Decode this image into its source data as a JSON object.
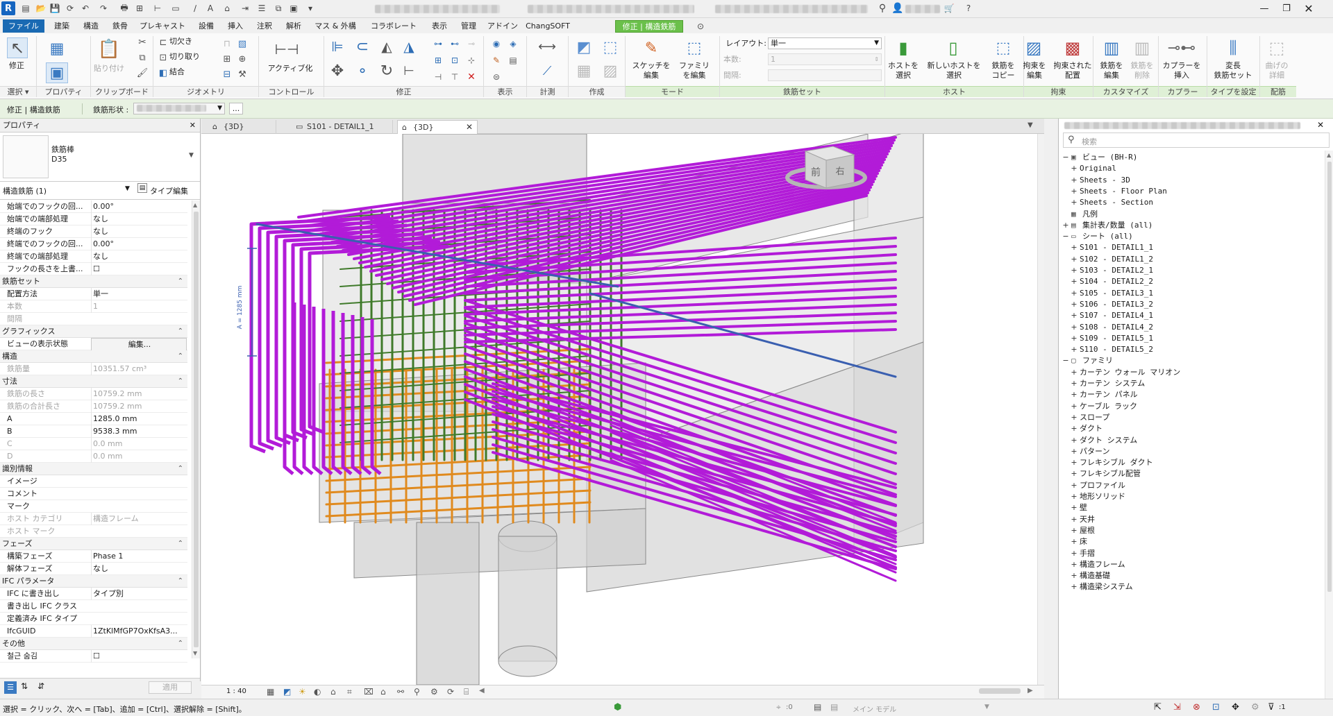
{
  "title_bar": {
    "app_logo": "R",
    "quick_access_icons": [
      "open-icon",
      "save-icon",
      "sync-icon",
      "undo-icon",
      "redo-icon",
      "print-icon",
      "measure-icon",
      "dimension-icon",
      "text-icon",
      "3d-view-icon",
      "section-icon",
      "close-hidden-icon",
      "switch-windows-icon"
    ],
    "window_buttons": [
      "minimize",
      "restore",
      "close"
    ]
  },
  "menu": {
    "file": "ファイル",
    "tabs": [
      "建築",
      "構造",
      "鉄骨",
      "プレキャスト",
      "設備",
      "挿入",
      "注釈",
      "解析",
      "マス & 外構",
      "コラボレート",
      "表示",
      "管理",
      "アドイン",
      "ChangSOFT"
    ],
    "context_tab": "修正 | 構造鉄筋"
  },
  "ribbon": {
    "modify": "修正",
    "properties": "プロパティ",
    "paste": "貼り付け",
    "cut": "切欠き",
    "join_cut": "切り取り",
    "join": "結合",
    "activate": "アクティブ化",
    "sketch_edit": "スケッチを\n編集",
    "family_edit": "ファミリ\nを編集",
    "layout_label": "レイアウト:",
    "layout_value": "単一",
    "count_label": "本数:",
    "count_value": "1",
    "spacing_label": "間隔:",
    "host_select": "ホストを\n選択",
    "new_host_select": "新しいホストを\n選択",
    "rebar_copy": "鉄筋を\nコピー",
    "constraint_edit": "拘束を\n編集",
    "constrained_place": "拘束された\n配置",
    "rebar_edit": "鉄筋を\n編集",
    "rebar_delete": "鉄筋を\n削除",
    "coupler_insert": "カプラーを\n挿入",
    "vary_set": "変長\n鉄筋セット",
    "bend_detail": "曲げの\n詳細",
    "panels": {
      "select": "選択",
      "properties": "プロパティ",
      "clipboard": "クリップボード",
      "geometry": "ジオメトリ",
      "control": "コントロール",
      "modify": "修正",
      "view": "表示",
      "measure": "計測",
      "create": "作成",
      "mode": "モード",
      "rebar_set": "鉄筋セット",
      "host": "ホスト",
      "constraint": "拘束",
      "customize": "カスタマイズ",
      "coupler": "カプラー",
      "set_type": "タイプを設定",
      "reinforcement": "配筋"
    }
  },
  "options_bar": {
    "context": "修正 | 構造鉄筋",
    "shape_label": "鉄筋形状 :",
    "more": "..."
  },
  "properties": {
    "header": "プロパティ",
    "family_name": "鉄筋棒",
    "type_name": "D35",
    "selector": "構造鉄筋 (1)",
    "edit_type": "タイプ編集",
    "rows": [
      {
        "k": "始端でのフックの回...",
        "v": "0.00°",
        "dis": false
      },
      {
        "k": "始端での端部処理",
        "v": "なし",
        "dis": false
      },
      {
        "k": "終端のフック",
        "v": "なし",
        "dis": false
      },
      {
        "k": "終端でのフックの回...",
        "v": "0.00°",
        "dis": false
      },
      {
        "k": "終端での端部処理",
        "v": "なし",
        "dis": false
      },
      {
        "k": "フックの長さを上書...",
        "v": "☐",
        "dis": false
      }
    ],
    "groups": [
      {
        "name": "鉄筋セット",
        "rows": [
          {
            "k": "配置方法",
            "v": "単一",
            "dis": false
          },
          {
            "k": "本数",
            "v": "1",
            "dis": true
          },
          {
            "k": "間隔",
            "v": "",
            "dis": true
          }
        ]
      },
      {
        "name": "グラフィックス",
        "rows": [
          {
            "k": "ビューの表示状態",
            "v": "編集...",
            "dis": false,
            "button": true
          }
        ]
      },
      {
        "name": "構造",
        "rows": [
          {
            "k": "鉄筋量",
            "v": "10351.57 cm³",
            "dis": true
          }
        ]
      },
      {
        "name": "寸法",
        "rows": [
          {
            "k": "鉄筋の長さ",
            "v": "10759.2 mm",
            "dis": true
          },
          {
            "k": "鉄筋の合計長さ",
            "v": "10759.2 mm",
            "dis": true
          },
          {
            "k": "A",
            "v": "1285.0 mm",
            "dis": false
          },
          {
            "k": "B",
            "v": "9538.3 mm",
            "dis": false
          },
          {
            "k": "C",
            "v": "0.0 mm",
            "dis": true
          },
          {
            "k": "D",
            "v": "0.0 mm",
            "dis": true
          }
        ]
      },
      {
        "name": "識別情報",
        "rows": [
          {
            "k": "イメージ",
            "v": "",
            "dis": false
          },
          {
            "k": "コメント",
            "v": "",
            "dis": false
          },
          {
            "k": "マーク",
            "v": "",
            "dis": false
          },
          {
            "k": "ホスト カテゴリ",
            "v": "構造フレーム",
            "dis": true
          },
          {
            "k": "ホスト マーク",
            "v": "",
            "dis": true
          }
        ]
      },
      {
        "name": "フェーズ",
        "rows": [
          {
            "k": "構築フェーズ",
            "v": "Phase 1",
            "dis": false
          },
          {
            "k": "解体フェーズ",
            "v": "なし",
            "dis": false
          }
        ]
      },
      {
        "name": "IFC パラメータ",
        "rows": [
          {
            "k": "IFC に書き出し",
            "v": "タイプ別",
            "dis": false
          },
          {
            "k": "書き出し IFC クラス",
            "v": "",
            "dis": false
          },
          {
            "k": "定義済み IFC タイプ",
            "v": "",
            "dis": false
          },
          {
            "k": "IfcGUID",
            "v": "1ZtKlMfGP7OxKfsA3...",
            "dis": false
          }
        ]
      },
      {
        "name": "その他",
        "rows": [
          {
            "k": "철근 숨김",
            "v": "☐",
            "dis": false
          }
        ]
      }
    ],
    "apply": "適用"
  },
  "view_tabs": [
    {
      "label": "{3D}",
      "active": false
    },
    {
      "label": "S101 - DETAIL1_1",
      "active": false
    },
    {
      "label": "{3D}",
      "active": true
    }
  ],
  "viewport": {
    "dimension_label": "A = 1285 mm",
    "viewcube_front": "前",
    "viewcube_right": "右",
    "scale": "1 : 40"
  },
  "browser": {
    "search_placeholder": "検索",
    "tree": [
      {
        "lvl": 0,
        "tg": "−",
        "icon": "view",
        "label": "ビュー (BH-R)"
      },
      {
        "lvl": 1,
        "tg": "+",
        "icon": "",
        "label": "Original"
      },
      {
        "lvl": 1,
        "tg": "+",
        "icon": "",
        "label": "Sheets - 3D"
      },
      {
        "lvl": 1,
        "tg": "+",
        "icon": "",
        "label": "Sheets - Floor Plan"
      },
      {
        "lvl": 1,
        "tg": "+",
        "icon": "",
        "label": "Sheets - Section"
      },
      {
        "lvl": 0,
        "tg": "",
        "icon": "legend",
        "label": "凡例"
      },
      {
        "lvl": 0,
        "tg": "+",
        "icon": "schedule",
        "label": "集計表/数量 (all)"
      },
      {
        "lvl": 0,
        "tg": "−",
        "icon": "sheet",
        "label": "シート (all)"
      },
      {
        "lvl": 1,
        "tg": "+",
        "icon": "",
        "label": "S101 - DETAIL1_1"
      },
      {
        "lvl": 1,
        "tg": "+",
        "icon": "",
        "label": "S102 - DETAIL1_2"
      },
      {
        "lvl": 1,
        "tg": "+",
        "icon": "",
        "label": "S103 - DETAIL2_1"
      },
      {
        "lvl": 1,
        "tg": "+",
        "icon": "",
        "label": "S104 - DETAIL2_2"
      },
      {
        "lvl": 1,
        "tg": "+",
        "icon": "",
        "label": "S105 - DETAIL3_1"
      },
      {
        "lvl": 1,
        "tg": "+",
        "icon": "",
        "label": "S106 - DETAIL3_2"
      },
      {
        "lvl": 1,
        "tg": "+",
        "icon": "",
        "label": "S107 - DETAIL4_1"
      },
      {
        "lvl": 1,
        "tg": "+",
        "icon": "",
        "label": "S108 - DETAIL4_2"
      },
      {
        "lvl": 1,
        "tg": "+",
        "icon": "",
        "label": "S109 - DETAIL5_1"
      },
      {
        "lvl": 1,
        "tg": "+",
        "icon": "",
        "label": "S110 - DETAIL5_2"
      },
      {
        "lvl": 0,
        "tg": "−",
        "icon": "family",
        "label": "ファミリ"
      },
      {
        "lvl": 1,
        "tg": "+",
        "icon": "",
        "label": "カーテン ウォール マリオン"
      },
      {
        "lvl": 1,
        "tg": "+",
        "icon": "",
        "label": "カーテン システム"
      },
      {
        "lvl": 1,
        "tg": "+",
        "icon": "",
        "label": "カーテン パネル"
      },
      {
        "lvl": 1,
        "tg": "+",
        "icon": "",
        "label": "ケーブル ラック"
      },
      {
        "lvl": 1,
        "tg": "+",
        "icon": "",
        "label": "スロープ"
      },
      {
        "lvl": 1,
        "tg": "+",
        "icon": "",
        "label": "ダクト"
      },
      {
        "lvl": 1,
        "tg": "+",
        "icon": "",
        "label": "ダクト システム"
      },
      {
        "lvl": 1,
        "tg": "+",
        "icon": "",
        "label": "パターン"
      },
      {
        "lvl": 1,
        "tg": "+",
        "icon": "",
        "label": "フレキシブル ダクト"
      },
      {
        "lvl": 1,
        "tg": "+",
        "icon": "",
        "label": "フレキシブル配管"
      },
      {
        "lvl": 1,
        "tg": "+",
        "icon": "",
        "label": "プロファイル"
      },
      {
        "lvl": 1,
        "tg": "+",
        "icon": "",
        "label": "地形ソリッド"
      },
      {
        "lvl": 1,
        "tg": "+",
        "icon": "",
        "label": "壁"
      },
      {
        "lvl": 1,
        "tg": "+",
        "icon": "",
        "label": "天井"
      },
      {
        "lvl": 1,
        "tg": "+",
        "icon": "",
        "label": "屋根"
      },
      {
        "lvl": 1,
        "tg": "+",
        "icon": "",
        "label": "床"
      },
      {
        "lvl": 1,
        "tg": "+",
        "icon": "",
        "label": "手摺"
      },
      {
        "lvl": 1,
        "tg": "+",
        "icon": "",
        "label": "構造フレーム"
      },
      {
        "lvl": 1,
        "tg": "+",
        "icon": "",
        "label": "構造基礎"
      },
      {
        "lvl": 1,
        "tg": "+",
        "icon": "",
        "label": "構造梁システム"
      }
    ]
  },
  "status": {
    "hint": "選択 = クリック、次へ = [Tab]、追加 = [Ctrl]、選択解除 = [Shift]。",
    "workset_count": ":0",
    "model": "メイン モデル",
    "filter_count": ":1"
  },
  "colors": {
    "rebar_main": "#b21bd8",
    "rebar_stirrup": "#3f7a2a",
    "rebar_bottom": "#e08a1e",
    "rebar_blue": "#3a5fb0",
    "context_tab": "#6bc04b",
    "file_tab": "#1a6ab3"
  }
}
